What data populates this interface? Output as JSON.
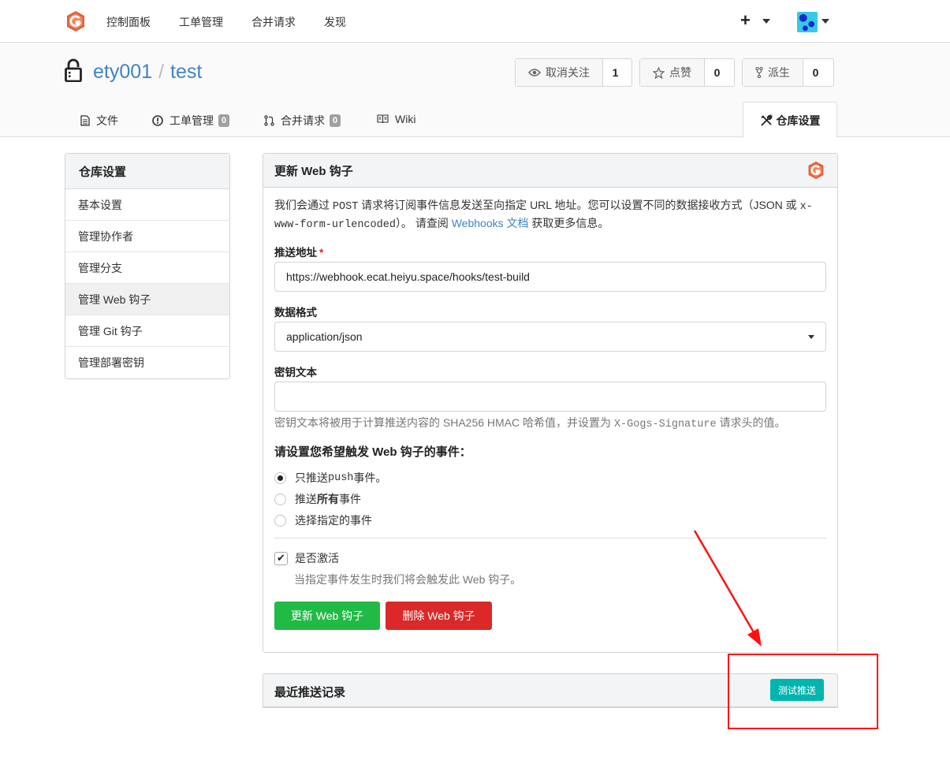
{
  "topnav": {
    "items": [
      "控制面板",
      "工单管理",
      "合并请求",
      "发现"
    ],
    "plus": "+"
  },
  "repo": {
    "owner": "ety001",
    "separator": "/",
    "name": "test",
    "watch_label": "取消关注",
    "watch_count": "1",
    "star_label": "点赞",
    "star_count": "0",
    "fork_label": "派生",
    "fork_count": "0"
  },
  "tabs": {
    "files": "文件",
    "issues": "工单管理",
    "issues_count": "0",
    "pulls": "合并请求",
    "pulls_count": "0",
    "wiki": "Wiki",
    "settings": "仓库设置"
  },
  "sidebar": {
    "header": "仓库设置",
    "items": [
      "基本设置",
      "管理协作者",
      "管理分支",
      "管理 Web 钩子",
      "管理 Git 钩子",
      "管理部署密钥"
    ]
  },
  "panel": {
    "title": "更新 Web 钩子",
    "desc_1": "我们会通过 ",
    "desc_post": "POST",
    "desc_2": " 请求将订阅事件信息发送至向指定 URL 地址。您可以设置不同的数据接收方式（JSON 或 ",
    "desc_urlenc": "x-www-form-urlencoded",
    "desc_3": "）。 请查阅 ",
    "desc_link": "Webhooks 文档",
    "desc_4": " 获取更多信息。",
    "url_label": "推送地址",
    "url_required": "*",
    "url_value": "https://webhook.ecat.heiyu.space/hooks/test-build",
    "format_label": "数据格式",
    "format_value": "application/json",
    "secret_label": "密钥文本",
    "secret_value": "",
    "secret_help_1": "密钥文本将被用于计算推送内容的 SHA256 HMAC 哈希值，并设置为 ",
    "secret_help_header": "X-Gogs-Signature",
    "secret_help_2": " 请求头的值。",
    "events_title": "请设置您希望触发 Web 钩子的事件：",
    "event_push_1": "只推送 ",
    "event_push_code": "push",
    "event_push_2": " 事件。",
    "event_all_1": "推送 ",
    "event_all_bold": "所有",
    "event_all_2": " 事件",
    "event_choose": "选择指定的事件",
    "active_label": "是否激活",
    "active_help": "当指定事件发生时我们将会触发此 Web 钩子。",
    "update_button": "更新 Web 钩子",
    "delete_button": "删除 Web 钩子"
  },
  "recent": {
    "title": "最近推送记录",
    "test_button": "测试推送"
  },
  "colors": {
    "green": "#21ba45",
    "red": "#db2828",
    "teal": "#00b5ad",
    "link": "#4183c4",
    "annotation": "#ff1111"
  }
}
